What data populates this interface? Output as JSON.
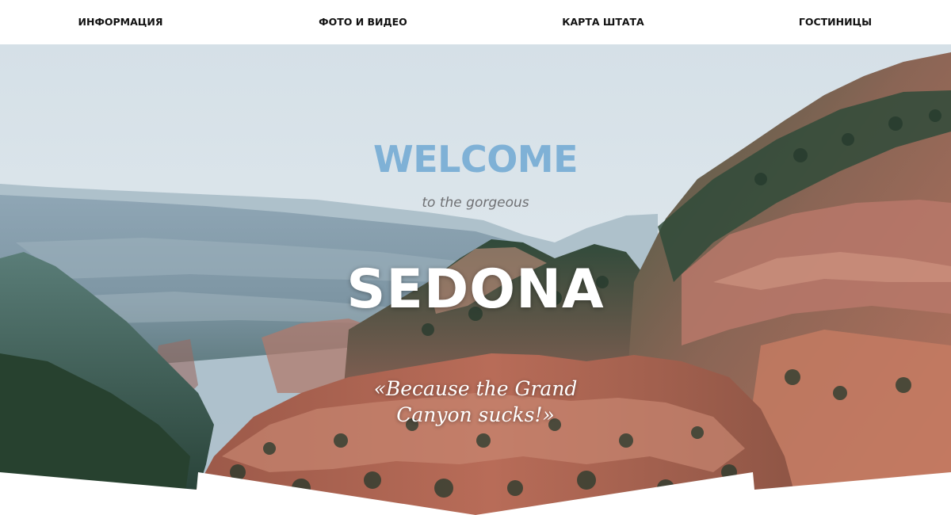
{
  "nav": {
    "items": [
      {
        "label": "ИНФОРМАЦИЯ"
      },
      {
        "label": "ФОТО И ВИДЕО"
      },
      {
        "label": "КАРТА ШТАТА"
      },
      {
        "label": "ГОСТИНИЦЫ"
      }
    ]
  },
  "hero": {
    "welcome": "WELCOME",
    "tagline": "to the gorgeous",
    "city": "SEDONA",
    "quote_line1": "«Because the Grand",
    "quote_line2": "Canyon sucks!»",
    "image": "sedona-canyon-landscape"
  },
  "colors": {
    "nav_background": "#ffffff",
    "nav_text": "#111111",
    "welcome": "#7fb1d6",
    "tagline": "#6f7073",
    "headline": "#ffffff",
    "sky": "#dce6ec",
    "red_rock": "#b8675a",
    "forest": "#2f4f3f"
  }
}
